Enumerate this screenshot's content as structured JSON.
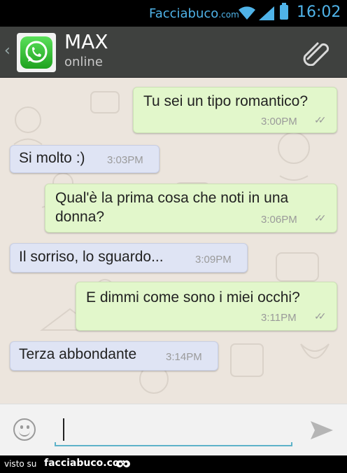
{
  "status_bar": {
    "brand": "Facciabuco",
    "brand_suffix": ".com",
    "time": "16:02",
    "icons": [
      "wifi-icon",
      "signal-icon",
      "battery-icon"
    ],
    "accent_color": "#4fb3e8"
  },
  "header": {
    "contact_name": "MAX",
    "contact_status": "online",
    "avatar_icon": "whatsapp-logo",
    "attach_icon": "paperclip-icon"
  },
  "messages": [
    {
      "direction": "out",
      "text": "Tu sei un tipo romantico?",
      "time": "3:00PM",
      "ticks": "double-check-icon"
    },
    {
      "direction": "in",
      "text": "Si molto :)",
      "time": "3:03PM"
    },
    {
      "direction": "out",
      "text_line1": "Qual'è la prima cosa che noti in una",
      "text_line2": "donna?",
      "time": "3:06PM",
      "ticks": "double-check-icon"
    },
    {
      "direction": "in",
      "text": "Il sorriso, lo sguardo...",
      "time": "3:09PM"
    },
    {
      "direction": "out",
      "text": "E dimmi come sono i miei occhi?",
      "time": "3:11PM",
      "ticks": "double-check-icon"
    },
    {
      "direction": "in",
      "text": "Terza abbondante",
      "time": "3:14PM"
    }
  ],
  "colors": {
    "outgoing_bubble": "#e2f7cb",
    "incoming_bubble": "#dfe4f4",
    "chat_background": "#ece5dd",
    "header": "#3f413f"
  },
  "input_bar": {
    "value": "",
    "emoji_icon": "smiley-icon",
    "send_icon": "send-arrow-icon"
  },
  "footer": {
    "prefix": "visto su",
    "site": "facciabuco.com"
  }
}
